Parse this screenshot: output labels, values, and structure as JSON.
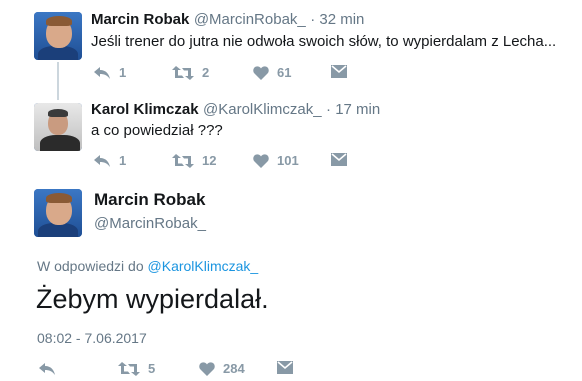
{
  "tweet1": {
    "name": "Marcin Robak",
    "handle": "@MarcinRobak_",
    "time": "· 32 min",
    "text": "Jeśli trener do jutra nie odwoła swoich słów, to wypierdalam z Lecha...",
    "replies": "1",
    "retweets": "2",
    "likes": "61"
  },
  "tweet2": {
    "name": "Karol Klimczak",
    "handle": "@KarolKlimczak_",
    "time": "· 17 min",
    "text": "a co powiedział ???",
    "replies": "1",
    "retweets": "12",
    "likes": "101"
  },
  "tweet3": {
    "name": "Marcin Robak",
    "handle": "@MarcinRobak_",
    "reply_prefix": "W odpowiedzi do",
    "reply_to": "@KarolKlimczak_",
    "text": "Żebym wypierdalał.",
    "timestamp": "08:02 - 7.06.2017",
    "retweets": "5",
    "likes": "284"
  },
  "colors": {
    "link": "#1b95e0",
    "muted": "#657786",
    "icon": "#8899a6",
    "thread": "#ccd6dd"
  }
}
